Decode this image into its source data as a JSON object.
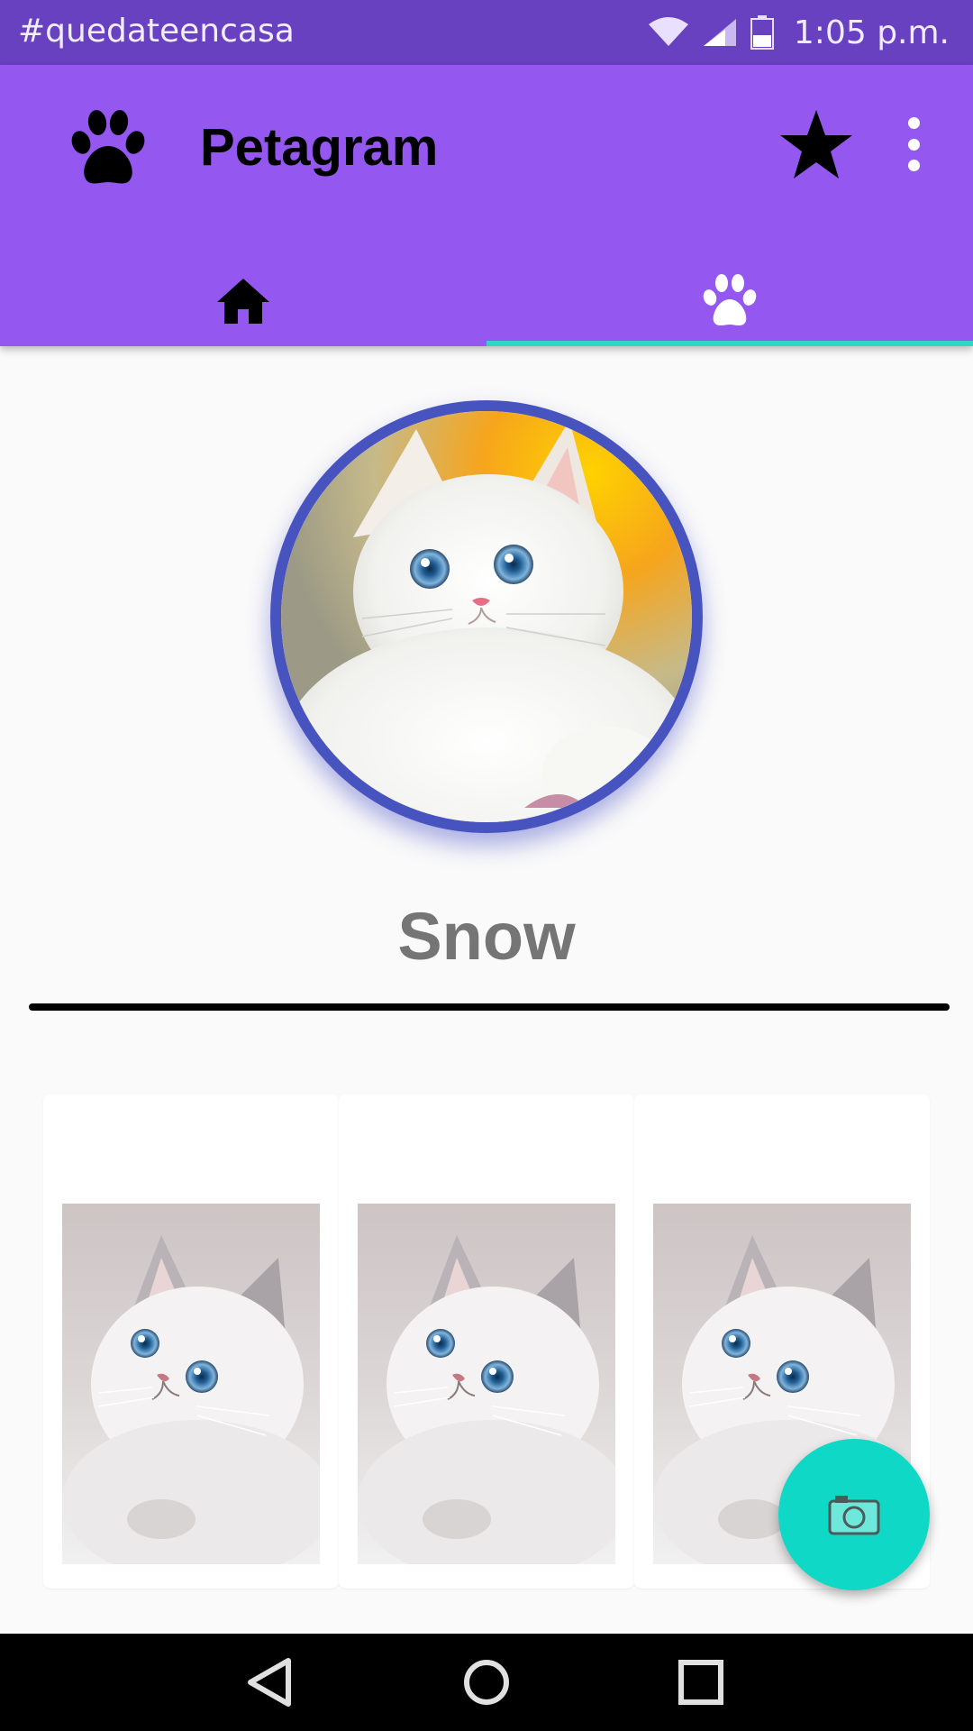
{
  "status_bar": {
    "carrier_text": "#quedateencasa",
    "time": "1:05 p.m.",
    "icons": [
      "wifi-icon",
      "signal-icon",
      "battery-icon"
    ]
  },
  "app_bar": {
    "title": "Petagram",
    "logo_icon": "paw-icon",
    "actions": [
      "star-icon",
      "more-vert-icon"
    ],
    "background_color": "#9457ef"
  },
  "tabs": [
    {
      "icon": "home-icon",
      "selected": false
    },
    {
      "icon": "paw-icon",
      "selected": true
    }
  ],
  "profile": {
    "name": "Snow",
    "ring_color": "#4753bf"
  },
  "gallery": {
    "items": [
      {
        "image": "white-kitten-photo"
      },
      {
        "image": "white-kitten-photo"
      },
      {
        "image": "white-kitten-photo"
      }
    ]
  },
  "fab": {
    "icon": "camera-icon",
    "color": "#0fd9c6"
  },
  "nav_bar": {
    "buttons": [
      "back-icon",
      "home-circle-icon",
      "recents-icon"
    ]
  },
  "colors": {
    "accent": "#2ed6c6",
    "status_bar": "#6741bf",
    "name_text": "#757575"
  }
}
